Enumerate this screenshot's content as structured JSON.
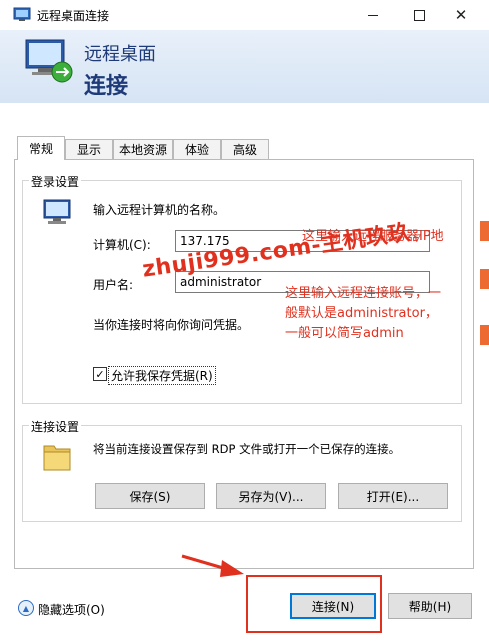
{
  "window": {
    "title": "远程桌面连接",
    "controls": [
      "minimize-icon",
      "maximize-icon",
      "close-icon"
    ]
  },
  "header": {
    "line1": "远程桌面",
    "line2": "连接"
  },
  "tabs": [
    {
      "label": "常规",
      "active": true
    },
    {
      "label": "显示"
    },
    {
      "label": "本地资源"
    },
    {
      "label": "体验"
    },
    {
      "label": "高级"
    }
  ],
  "login": {
    "group_label": "登录设置",
    "prompt": "输入远程计算机的名称。",
    "computer_label": "计算机(C):",
    "computer_value": "137.175",
    "username_label": "用户名:",
    "username_value": "administrator",
    "credential_note": "当你连接时将向你询问凭据。",
    "save_checkbox_label": "允许我保存凭据(R)",
    "save_checked": true
  },
  "connection": {
    "group_label": "连接设置",
    "description": "将当前连接设置保存到 RDP 文件或打开一个已保存的连接。",
    "save_button": "保存(S)",
    "save_as_button": "另存为(V)...",
    "open_button": "打开(E)..."
  },
  "footer": {
    "hide_options": "隐藏选项(O)",
    "connect_button": "连接(N)",
    "help_button": "帮助(H)"
  },
  "annotations": {
    "note_ip": "这里输入远程服务器IP地",
    "note_user_1": "这里输入远程连接账号，一",
    "note_user_2": "般默认是administrator，",
    "note_user_3": "一般可以简写admin",
    "watermark": "zhuji999.com-主机玖玖"
  },
  "colors": {
    "accent": "#0078d7",
    "annotation": "#e0301e",
    "header_text": "#1e3a78"
  }
}
